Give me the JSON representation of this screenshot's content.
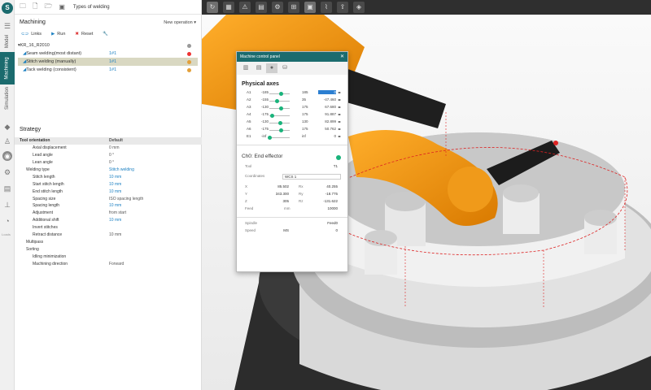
{
  "app": {
    "logo_letter": "S"
  },
  "left_nav": {
    "tabs": [
      {
        "label": "Model"
      },
      {
        "label": "Machining"
      },
      {
        "label": "Simulation"
      }
    ],
    "bottom_text": "Loads"
  },
  "panel": {
    "topbar_title": "Types of welding",
    "section_machining": "Machining",
    "new_operation": "New operation",
    "actions": {
      "links": "Links",
      "run": "Run",
      "reset": "Reset"
    },
    "project": "KR_16_R2010",
    "operations": [
      {
        "name": "Seam welding(most distant)",
        "count": "1#1"
      },
      {
        "name": "Stitch welding (manually)",
        "count": "1#1"
      },
      {
        "name": "Tack welding (consistent)",
        "count": "1#1"
      }
    ],
    "strategy_title": "Strategy",
    "strategy": [
      {
        "k": "Tool orientation",
        "v": "Default",
        "head": true,
        "indent": 0
      },
      {
        "k": "Axial displacement",
        "v": "0 mm",
        "indent": 2
      },
      {
        "k": "Lead angle",
        "v": "0 °",
        "indent": 2
      },
      {
        "k": "Lean angle",
        "v": "0 °",
        "indent": 2
      },
      {
        "k": "Welding type",
        "v": "Stitch welding",
        "blue": true,
        "indent": 1
      },
      {
        "k": "Stitch length",
        "v": "10 mm",
        "blue": true,
        "indent": 2
      },
      {
        "k": "Start stitch length",
        "v": "10 mm",
        "blue": true,
        "indent": 2
      },
      {
        "k": "End stitch length",
        "v": "10 mm",
        "blue": true,
        "indent": 2
      },
      {
        "k": "Spacing size",
        "v": "ISO spacing length",
        "indent": 2
      },
      {
        "k": "Spacing length",
        "v": "10 mm",
        "blue": true,
        "indent": 2
      },
      {
        "k": "Adjustment",
        "v": "from start",
        "indent": 2
      },
      {
        "k": "Additional shift",
        "v": "10 mm",
        "blue": true,
        "indent": 2
      },
      {
        "k": "Invert stitches",
        "v": "",
        "indent": 2
      },
      {
        "k": "Retract distance",
        "v": "10 mm",
        "indent": 2
      },
      {
        "k": "Multipass",
        "v": "",
        "indent": 1
      },
      {
        "k": "Sorting",
        "v": "",
        "indent": 1
      },
      {
        "k": "Idling minimization",
        "v": "",
        "indent": 2
      },
      {
        "k": "Machining direction",
        "v": "Forward",
        "indent": 2
      }
    ]
  },
  "mcp": {
    "title": "Machine control panel",
    "physical_axes_title": "Physical axes",
    "axes": [
      {
        "name": "A1",
        "min": "-185",
        "max": "185",
        "value": "0",
        "knob": 0.55,
        "selected": true
      },
      {
        "name": "A2",
        "min": "-155",
        "max": "35",
        "value": "-47.460",
        "knob": 0.35
      },
      {
        "name": "A3",
        "min": "-130",
        "max": "175",
        "value": "67.680",
        "knob": 0.55
      },
      {
        "name": "A4",
        "min": "-175",
        "max": "175",
        "value": "91.887",
        "knob": 0.1
      },
      {
        "name": "A5",
        "min": "-130",
        "max": "130",
        "value": "82.899",
        "knob": 0.5
      },
      {
        "name": "A6",
        "min": "-175",
        "max": "175",
        "value": "50.762",
        "knob": 0.55
      },
      {
        "name": "E1",
        "min": "-inf",
        "max": "inf",
        "value": "0",
        "knob": 0.0
      }
    ],
    "end_effector_title": "Ch0: End effector",
    "tool_label": "Tool",
    "tool_value": "T1",
    "coord_label": "Coordinates",
    "coord_value": "WCS 1",
    "coords": [
      {
        "a": "X",
        "av": "85.502",
        "b": "Rx",
        "bv": "40.255"
      },
      {
        "a": "Y",
        "av": "343.300",
        "b": "Ry",
        "bv": "-18.775"
      },
      {
        "a": "Z",
        "av": "305",
        "b": "Rz",
        "bv": "-131.622"
      }
    ],
    "feed_label": "Feed",
    "feed_unit": "mm",
    "feed_value": "10000",
    "spindle_label": "Spindle",
    "spindle_value": "Feed0",
    "speed_label": "Speed",
    "speed_value": "MS",
    "speed_num": "0"
  }
}
